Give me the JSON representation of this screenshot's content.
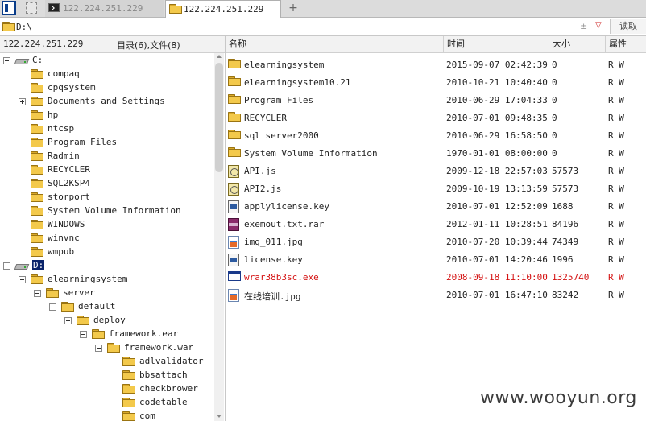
{
  "tabs": {
    "terminal_tab": "122.224.251.229",
    "file_tab": "122.224.251.229",
    "new_tab": "+"
  },
  "address": {
    "path": "D:\\",
    "plus_minus": "±",
    "dropdown": "▽",
    "read_button": "读取"
  },
  "left": {
    "ip": "122.224.251.229",
    "counts": "目录(6),文件(8)"
  },
  "tree": [
    {
      "type": "drive",
      "label": "C:",
      "expanded": true,
      "level": 0
    },
    {
      "type": "folder",
      "label": "compaq",
      "level": 1
    },
    {
      "type": "folder",
      "label": "cpqsystem",
      "level": 1
    },
    {
      "type": "folder",
      "label": "Documents and Settings",
      "level": 1,
      "collapsed": true
    },
    {
      "type": "folder",
      "label": "hp",
      "level": 1
    },
    {
      "type": "folder",
      "label": "ntcsp",
      "level": 1
    },
    {
      "type": "folder",
      "label": "Program Files",
      "level": 1
    },
    {
      "type": "folder",
      "label": "Radmin",
      "level": 1
    },
    {
      "type": "folder",
      "label": "RECYCLER",
      "level": 1
    },
    {
      "type": "folder",
      "label": "SQL2KSP4",
      "level": 1
    },
    {
      "type": "folder",
      "label": "storport",
      "level": 1
    },
    {
      "type": "folder",
      "label": "System Volume Information",
      "level": 1
    },
    {
      "type": "folder",
      "label": "WINDOWS",
      "level": 1
    },
    {
      "type": "folder",
      "label": "winvnc",
      "level": 1
    },
    {
      "type": "folder",
      "label": "wmpub",
      "level": 1
    },
    {
      "type": "drive",
      "label": "D:",
      "expanded": true,
      "selected": true,
      "level": 0
    },
    {
      "type": "folder",
      "label": "elearningsystem",
      "level": 1,
      "expanded": true
    },
    {
      "type": "folder",
      "label": "server",
      "level": 2,
      "expanded": true
    },
    {
      "type": "folder",
      "label": "default",
      "level": 3,
      "expanded": true
    },
    {
      "type": "folder",
      "label": "deploy",
      "level": 4,
      "expanded": true
    },
    {
      "type": "folder",
      "label": "framework.ear",
      "level": 5,
      "expanded": true
    },
    {
      "type": "folder",
      "label": "framework.war",
      "level": 6,
      "expanded": true
    },
    {
      "type": "folder",
      "label": "adlvalidator",
      "level": 7
    },
    {
      "type": "folder",
      "label": "bbsattach",
      "level": 7
    },
    {
      "type": "folder",
      "label": "checkbrower",
      "level": 7
    },
    {
      "type": "folder",
      "label": "codetable",
      "level": 7
    },
    {
      "type": "folder",
      "label": "com",
      "level": 7
    }
  ],
  "columns": {
    "name": "名称",
    "time": "时间",
    "size": "大小",
    "attr": "属性"
  },
  "files": [
    {
      "icon": "folder",
      "name": "elearningsystem",
      "time": "2015-09-07 02:42:39",
      "size": "0",
      "attr": "R W"
    },
    {
      "icon": "folder",
      "name": "elearningsystem10.21",
      "time": "2010-10-21 10:40:40",
      "size": "0",
      "attr": "R W"
    },
    {
      "icon": "folder",
      "name": "Program Files",
      "time": "2010-06-29 17:04:33",
      "size": "0",
      "attr": "R W"
    },
    {
      "icon": "folder",
      "name": "RECYCLER",
      "time": "2010-07-01 09:48:35",
      "size": "0",
      "attr": "R W"
    },
    {
      "icon": "folder",
      "name": "sql server2000",
      "time": "2010-06-29 16:58:50",
      "size": "0",
      "attr": "R W"
    },
    {
      "icon": "folder",
      "name": "System Volume Information",
      "time": "1970-01-01 08:00:00",
      "size": "0",
      "attr": "R W"
    },
    {
      "icon": "js",
      "name": "API.js",
      "time": "2009-12-18 22:57:03",
      "size": "57573",
      "attr": "R W"
    },
    {
      "icon": "js",
      "name": "API2.js",
      "time": "2009-10-19 13:13:59",
      "size": "57573",
      "attr": "R W"
    },
    {
      "icon": "doc",
      "name": "applylicense.key",
      "time": "2010-07-01 12:52:09",
      "size": "1688",
      "attr": "R W"
    },
    {
      "icon": "rar",
      "name": "exemout.txt.rar",
      "time": "2012-01-11 10:28:51",
      "size": "84196",
      "attr": "R W"
    },
    {
      "icon": "img",
      "name": "img_011.jpg",
      "time": "2010-07-20 10:39:44",
      "size": "74349",
      "attr": "R W"
    },
    {
      "icon": "doc",
      "name": "license.key",
      "time": "2010-07-01 14:20:46",
      "size": "1996",
      "attr": "R W"
    },
    {
      "icon": "exe",
      "name": "wrar38b3sc.exe",
      "time": "2008-09-18 11:10:00",
      "size": "1325740",
      "attr": "R W",
      "highlight": "#d41111"
    },
    {
      "icon": "img",
      "name": "在线培训.jpg",
      "time": "2010-07-01 16:47:10",
      "size": "83242",
      "attr": "R W"
    }
  ],
  "watermark": "www.wooyun.org",
  "colors": {
    "selection": "#0a246a",
    "folder": "#f3c94b",
    "highlight_text": "#d41111"
  }
}
